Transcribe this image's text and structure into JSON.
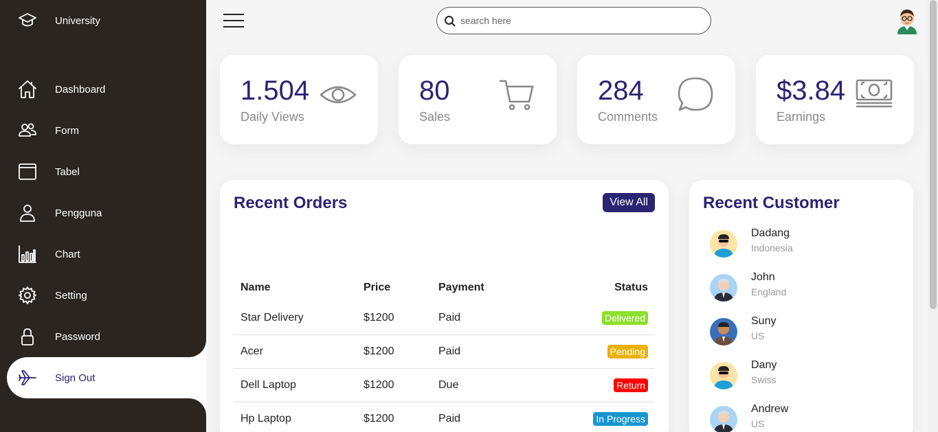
{
  "sidebar": {
    "brand": "University",
    "items": [
      {
        "label": "Dashboard",
        "icon": "home-icon"
      },
      {
        "label": "Form",
        "icon": "people-icon"
      },
      {
        "label": "Tabel",
        "icon": "browser-icon"
      },
      {
        "label": "Pengguna",
        "icon": "person-icon"
      },
      {
        "label": "Chart",
        "icon": "chart-icon"
      },
      {
        "label": "Setting",
        "icon": "gear-icon"
      },
      {
        "label": "Password",
        "icon": "lock-icon"
      },
      {
        "label": "Sign Out",
        "icon": "airplane-icon"
      }
    ]
  },
  "search": {
    "placeholder": "search here"
  },
  "cards": [
    {
      "number": "1.504",
      "label": "Daily Views",
      "icon": "eye-icon"
    },
    {
      "number": "80",
      "label": "Sales",
      "icon": "cart-icon"
    },
    {
      "number": "284",
      "label": "Comments",
      "icon": "chat-icon"
    },
    {
      "number": "$3.84",
      "label": "Earnings",
      "icon": "cash-icon"
    }
  ],
  "orders": {
    "title": "Recent Orders",
    "view_all": "View All",
    "headers": {
      "name": "Name",
      "price": "Price",
      "payment": "Payment",
      "status": "Status"
    },
    "rows": [
      {
        "name": "Star Delivery",
        "price": "$1200",
        "payment": "Paid",
        "status": "Delivered",
        "color": "#8de02c"
      },
      {
        "name": "Acer",
        "price": "$1200",
        "payment": "Paid",
        "status": "Pending",
        "color": "#e9b10a"
      },
      {
        "name": "Dell Laptop",
        "price": "$1200",
        "payment": "Due",
        "status": "Return",
        "color": "#f00"
      },
      {
        "name": "Hp Laptop",
        "price": "$1200",
        "payment": "Paid",
        "status": "In Progress",
        "color": "#1795ce"
      }
    ]
  },
  "customers": {
    "title": "Recent Customer",
    "list": [
      {
        "name": "Dadang",
        "country": "Indonesia"
      },
      {
        "name": "John",
        "country": "England"
      },
      {
        "name": "Suny",
        "country": "US"
      },
      {
        "name": "Dany",
        "country": "Swiss"
      },
      {
        "name": "Andrew",
        "country": "US"
      }
    ]
  },
  "colors": {
    "sidebar": "#2a2520",
    "accent": "#2a2473"
  }
}
